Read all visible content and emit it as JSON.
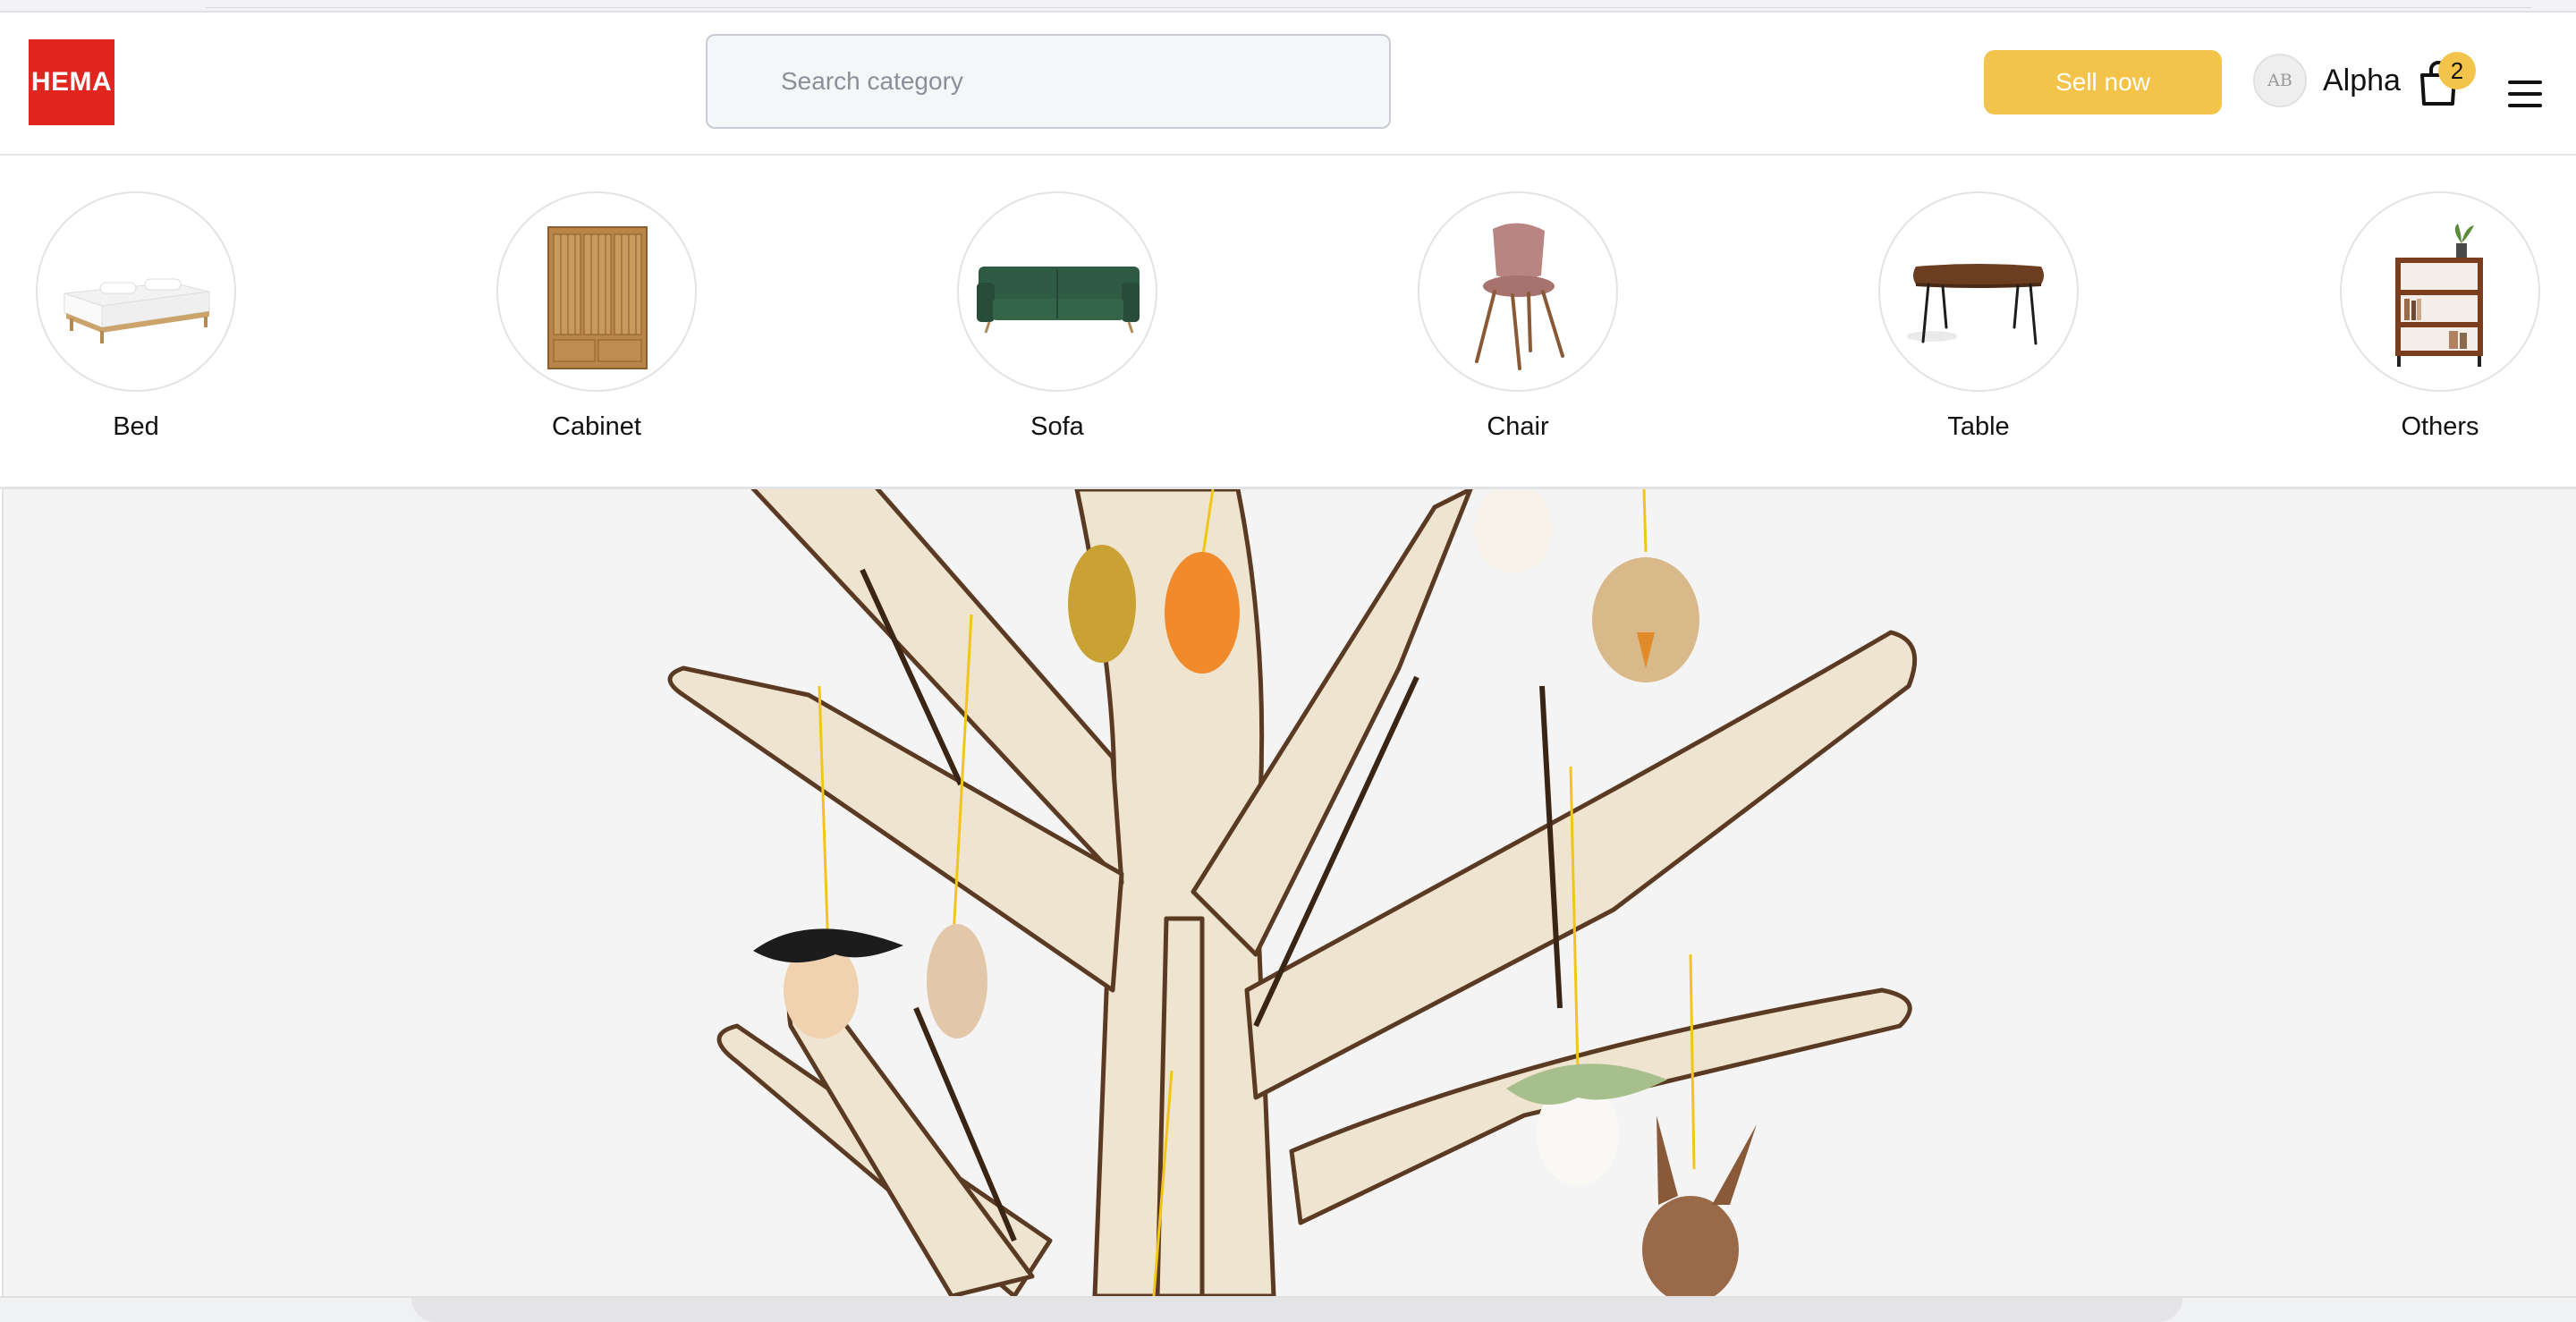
{
  "header": {
    "logo_text": "HEMA",
    "search": {
      "placeholder": "Search category",
      "value": ""
    },
    "sell_button_label": "Sell now",
    "user": {
      "avatar_initials": "AB",
      "name": "Alpha"
    },
    "cart": {
      "count": "2",
      "icon": "shopping-bag-icon"
    },
    "menu_icon": "hamburger-menu-icon"
  },
  "categories": [
    {
      "label": "Bed",
      "icon": "bed-image"
    },
    {
      "label": "Cabinet",
      "icon": "cabinet-image"
    },
    {
      "label": "Sofa",
      "icon": "sofa-image"
    },
    {
      "label": "Chair",
      "icon": "chair-image"
    },
    {
      "label": "Table",
      "icon": "table-image"
    },
    {
      "label": "Others",
      "icon": "bookshelf-image"
    }
  ],
  "colors": {
    "brand_red": "#e0261f",
    "accent_yellow": "#f3c449",
    "banner_bg": "#f4f4f4"
  }
}
